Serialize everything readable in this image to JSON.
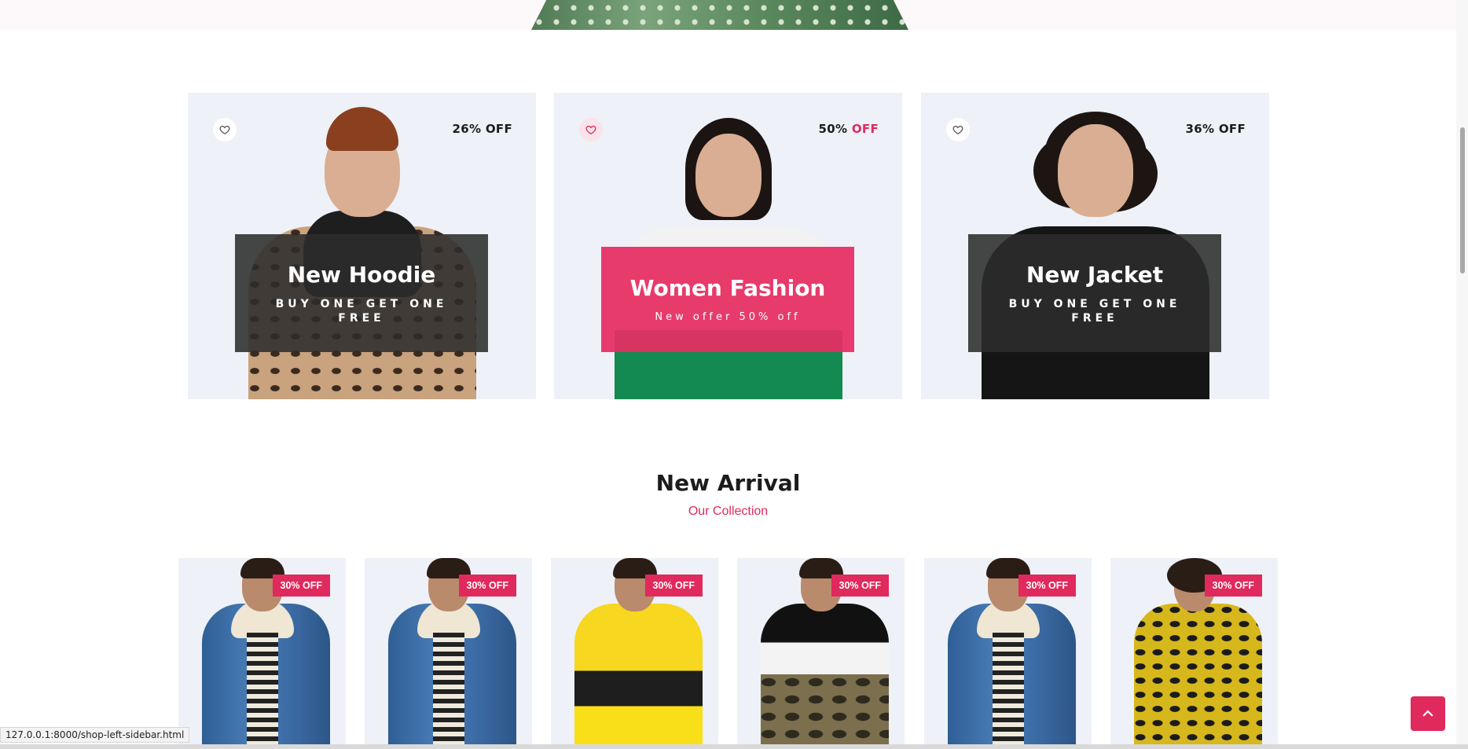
{
  "promos": [
    {
      "discount_value": "26%",
      "discount_label": "OFF",
      "title": "New Hoodie",
      "subtitle": "BUY ONE GET ONE FREE",
      "favorited": false
    },
    {
      "discount_value": "50%",
      "discount_label": "OFF",
      "title": "Women Fashion",
      "subtitle": "New offer 50% off",
      "favorited": true
    },
    {
      "discount_value": "36%",
      "discount_label": "OFF",
      "title": "New Jacket",
      "subtitle": "BUY ONE GET ONE FREE",
      "favorited": false
    }
  ],
  "section": {
    "title": "New Arrival",
    "subtitle": "Our Collection"
  },
  "products": [
    {
      "badge": "30% OFF",
      "image": "denim-jacket"
    },
    {
      "badge": "30% OFF",
      "image": "denim-jacket"
    },
    {
      "badge": "30% OFF",
      "image": "yellow-puffer-jacket"
    },
    {
      "badge": "30% OFF",
      "image": "camo-track-jacket"
    },
    {
      "badge": "30% OFF",
      "image": "denim-jacket"
    },
    {
      "badge": "30% OFF",
      "image": "yellow-fleece-jacket"
    }
  ],
  "status_bar": {
    "url": "127.0.0.1:8000/shop-left-sidebar.html"
  },
  "colors": {
    "accent": "#e0295c",
    "card_bg": "#eef1f7",
    "overlay_dark": "#2c2c2c"
  },
  "icons": {
    "favorite": "heart-icon",
    "scroll_top": "chevron-up-icon"
  }
}
